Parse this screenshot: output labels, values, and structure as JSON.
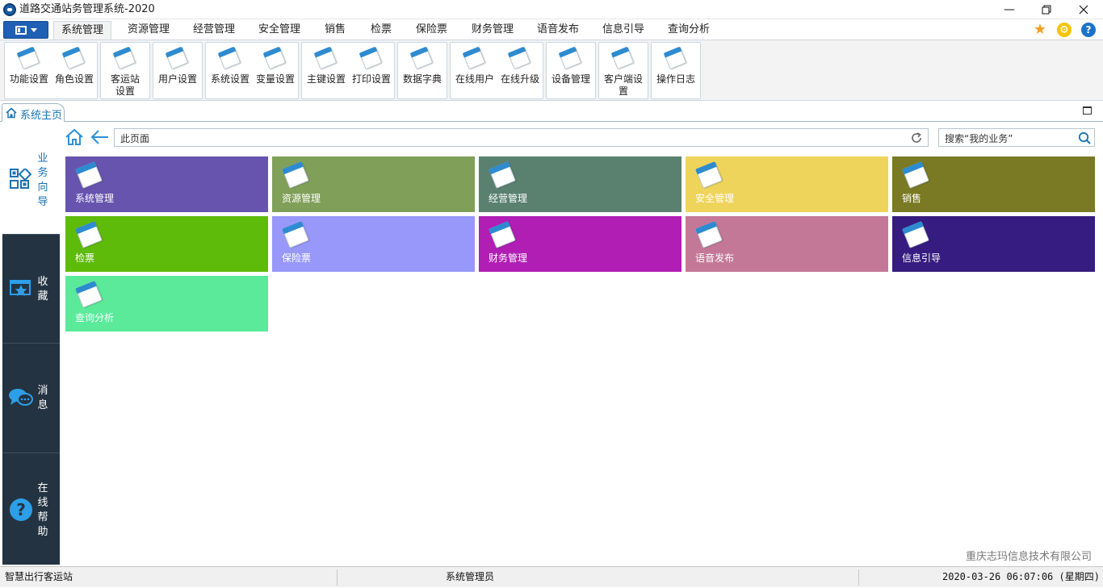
{
  "window": {
    "title": "道路交通站务管理系统-2020"
  },
  "menu": {
    "tabs": [
      "系统管理",
      "资源管理",
      "经营管理",
      "安全管理",
      "销售",
      "检票",
      "保险票",
      "财务管理",
      "语音发布",
      "信息引导",
      "查询分析"
    ],
    "active": "系统管理"
  },
  "ribbon": {
    "buttons": [
      "功能设置",
      "角色设置",
      "客运站设置",
      "用户设置",
      "系统设置",
      "变量设置",
      "主键设置",
      "打印设置",
      "数据字典",
      "在线用户",
      "在线升级",
      "设备管理",
      "客户端设置",
      "操作日志"
    ]
  },
  "doc_tab": {
    "label": "系统主页"
  },
  "left_nav": {
    "items": [
      {
        "label": "业务向导",
        "icon": "business-guide-icon"
      },
      {
        "label": "收藏",
        "icon": "favorites-icon"
      },
      {
        "label": "消息",
        "icon": "message-icon"
      },
      {
        "label": "在线帮助",
        "icon": "help-icon"
      }
    ]
  },
  "address": {
    "value": "此页面",
    "search_placeholder": "搜索“我的业务”"
  },
  "tiles": [
    {
      "label": "系统管理",
      "color": "#6654ae"
    },
    {
      "label": "资源管理",
      "color": "#80a05a"
    },
    {
      "label": "经营管理",
      "color": "#5a8070"
    },
    {
      "label": "安全管理",
      "color": "#efd45b"
    },
    {
      "label": "销售",
      "color": "#7a7a24"
    },
    {
      "label": "检票",
      "color": "#5ebb0a"
    },
    {
      "label": "保险票",
      "color": "#9898fa"
    },
    {
      "label": "财务管理",
      "color": "#b01eb4"
    },
    {
      "label": "语音发布",
      "color": "#c47898"
    },
    {
      "label": "信息引导",
      "color": "#361c80"
    },
    {
      "label": "查询分析",
      "color": "#5aea9a"
    }
  ],
  "company": "重庆志玛信息技术有限公司",
  "status": {
    "left": "智慧出行客运站",
    "user": "系统管理员",
    "datetime": "2020-03-26 06:07:06 (星期四)"
  },
  "colors": {
    "accent": "#1a73b5",
    "nav_dark": "#233341",
    "menu_button": "#1f5fb4"
  }
}
